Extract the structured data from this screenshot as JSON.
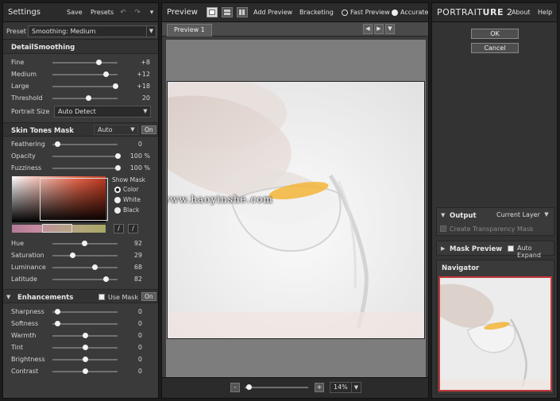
{
  "settings": {
    "title": "Settings",
    "save_label": "Save",
    "presets_label": "Presets",
    "preset_label": "Preset",
    "preset_value": "Smoothing: Medium"
  },
  "detail_smoothing": {
    "header": "DetailSmoothing",
    "sliders": [
      {
        "label": "Fine",
        "value": "+8",
        "fraction": 0.71
      },
      {
        "label": "Medium",
        "value": "+12",
        "fraction": 0.82
      },
      {
        "label": "Large",
        "value": "+18",
        "fraction": 0.96
      },
      {
        "label": "Threshold",
        "value": "20",
        "fraction": 0.55
      }
    ],
    "portrait_size_label": "Portrait Size",
    "portrait_size_value": "Auto Detect"
  },
  "skin_tones": {
    "header": "Skin Tones Mask",
    "mode_value": "Auto",
    "on_label": "On",
    "sliders": [
      {
        "label": "Feathering",
        "value": "0",
        "unit": "",
        "fraction": 0.07
      },
      {
        "label": "Opacity",
        "value": "100",
        "unit": "%",
        "fraction": 1.0
      },
      {
        "label": "Fuzziness",
        "value": "100",
        "unit": "%",
        "fraction": 1.0
      }
    ],
    "show_mask_label": "Show Mask",
    "show_mask_options": [
      "Color",
      "White",
      "Black"
    ],
    "hsl_sliders": [
      {
        "label": "Hue",
        "value": "92",
        "fraction": 0.49
      },
      {
        "label": "Saturation",
        "value": "29",
        "fraction": 0.31
      },
      {
        "label": "Luminance",
        "value": "68",
        "fraction": 0.65
      },
      {
        "label": "Latitude",
        "value": "82",
        "fraction": 0.82
      }
    ]
  },
  "enhancements": {
    "header": "Enhancements",
    "use_mask_label": "Use Mask",
    "on_label": "On",
    "sliders": [
      {
        "label": "Sharpness",
        "value": "0",
        "fraction": 0.07
      },
      {
        "label": "Softness",
        "value": "0",
        "fraction": 0.07
      },
      {
        "label": "Warmth",
        "value": "0",
        "fraction": 0.5
      },
      {
        "label": "Tint",
        "value": "0",
        "fraction": 0.5
      },
      {
        "label": "Brightness",
        "value": "0",
        "fraction": 0.5
      },
      {
        "label": "Contrast",
        "value": "0",
        "fraction": 0.5
      }
    ]
  },
  "preview": {
    "title": "Preview",
    "add_preview_label": "Add Preview",
    "bracketing_label": "Bracketing",
    "fast_preview_label": "Fast Preview",
    "accurate_label": "Accurate",
    "tab_label": "Preview 1",
    "zoom_value": "14%",
    "zoom_minus": "-",
    "zoom_plus": "+"
  },
  "right_panel": {
    "brand_prefix": "PORTRAIT",
    "brand_suffix": "URE",
    "brand_version": "2",
    "about_label": "About",
    "help_label": "Help",
    "ok_label": "OK",
    "cancel_label": "Cancel",
    "output_header": "Output",
    "output_value": "Current Layer",
    "create_transparency_label": "Create Transparency Mask",
    "mask_preview_header": "Mask Preview",
    "auto_expand_label": "Auto Expand",
    "navigator_header": "Navigator"
  },
  "watermark": "www.haoyinshe.com"
}
